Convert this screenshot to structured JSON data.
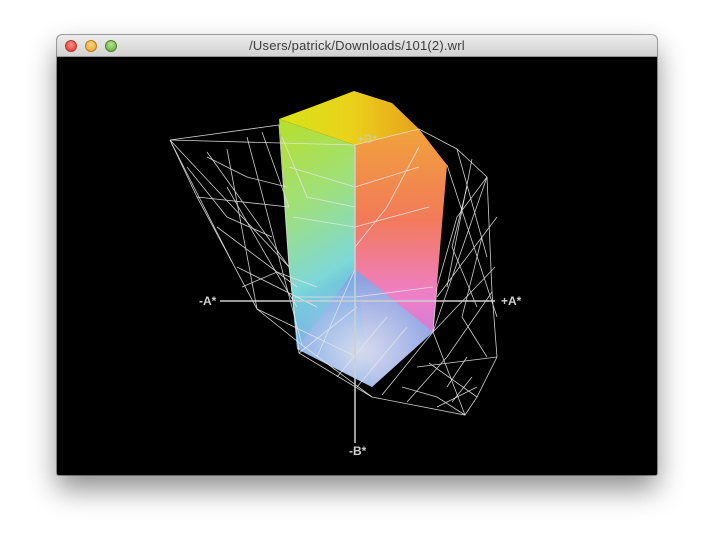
{
  "window": {
    "title": "/Users/patrick/Downloads/101(2).wrl"
  },
  "viewer": {
    "axis_labels": {
      "a_neg": "-A*",
      "a_pos": "+A*",
      "b_pos": "+B*",
      "b_neg": "-B*"
    },
    "colors": {
      "background": "#000000",
      "wireframe": "#e6e6e6",
      "axis": "#cfcfcf"
    }
  }
}
